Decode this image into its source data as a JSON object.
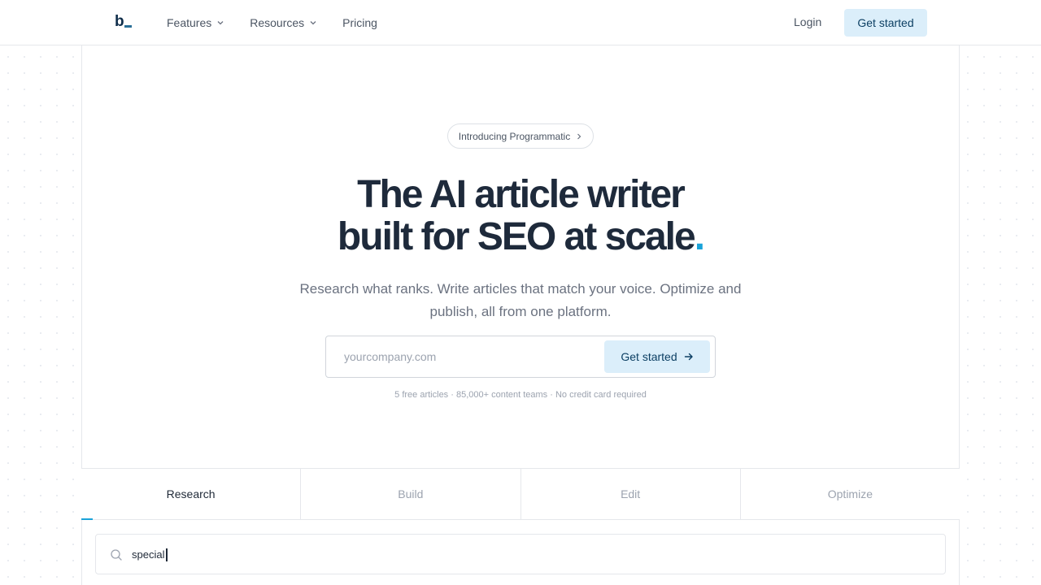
{
  "nav": {
    "logo": "b",
    "links": [
      {
        "label": "Features",
        "has_dropdown": true
      },
      {
        "label": "Resources",
        "has_dropdown": true
      },
      {
        "label": "Pricing",
        "has_dropdown": false
      }
    ],
    "login": "Login",
    "cta": "Get started"
  },
  "hero": {
    "badge": "Introducing Programmatic",
    "headline_line1": "The AI article writer",
    "headline_line2": "built for SEO at scale",
    "headline_dot": ".",
    "subtitle": "Research what ranks. Write articles that match your voice. Optimize and publish, all from one platform.",
    "email_placeholder": "yourcompany.com",
    "email_value": "",
    "cta": "Get started",
    "fine_print": "5 free articles · 85,000+ content teams · No credit card required"
  },
  "tabs": [
    {
      "label": "Research",
      "active": true
    },
    {
      "label": "Build",
      "active": false
    },
    {
      "label": "Edit",
      "active": false
    },
    {
      "label": "Optimize",
      "active": false
    }
  ],
  "search": {
    "value": "special"
  },
  "colors": {
    "accent": "#1aa3d9",
    "cta_bg": "#dbeefa",
    "cta_text": "#0c3f63",
    "heading": "#1e2a3b"
  }
}
